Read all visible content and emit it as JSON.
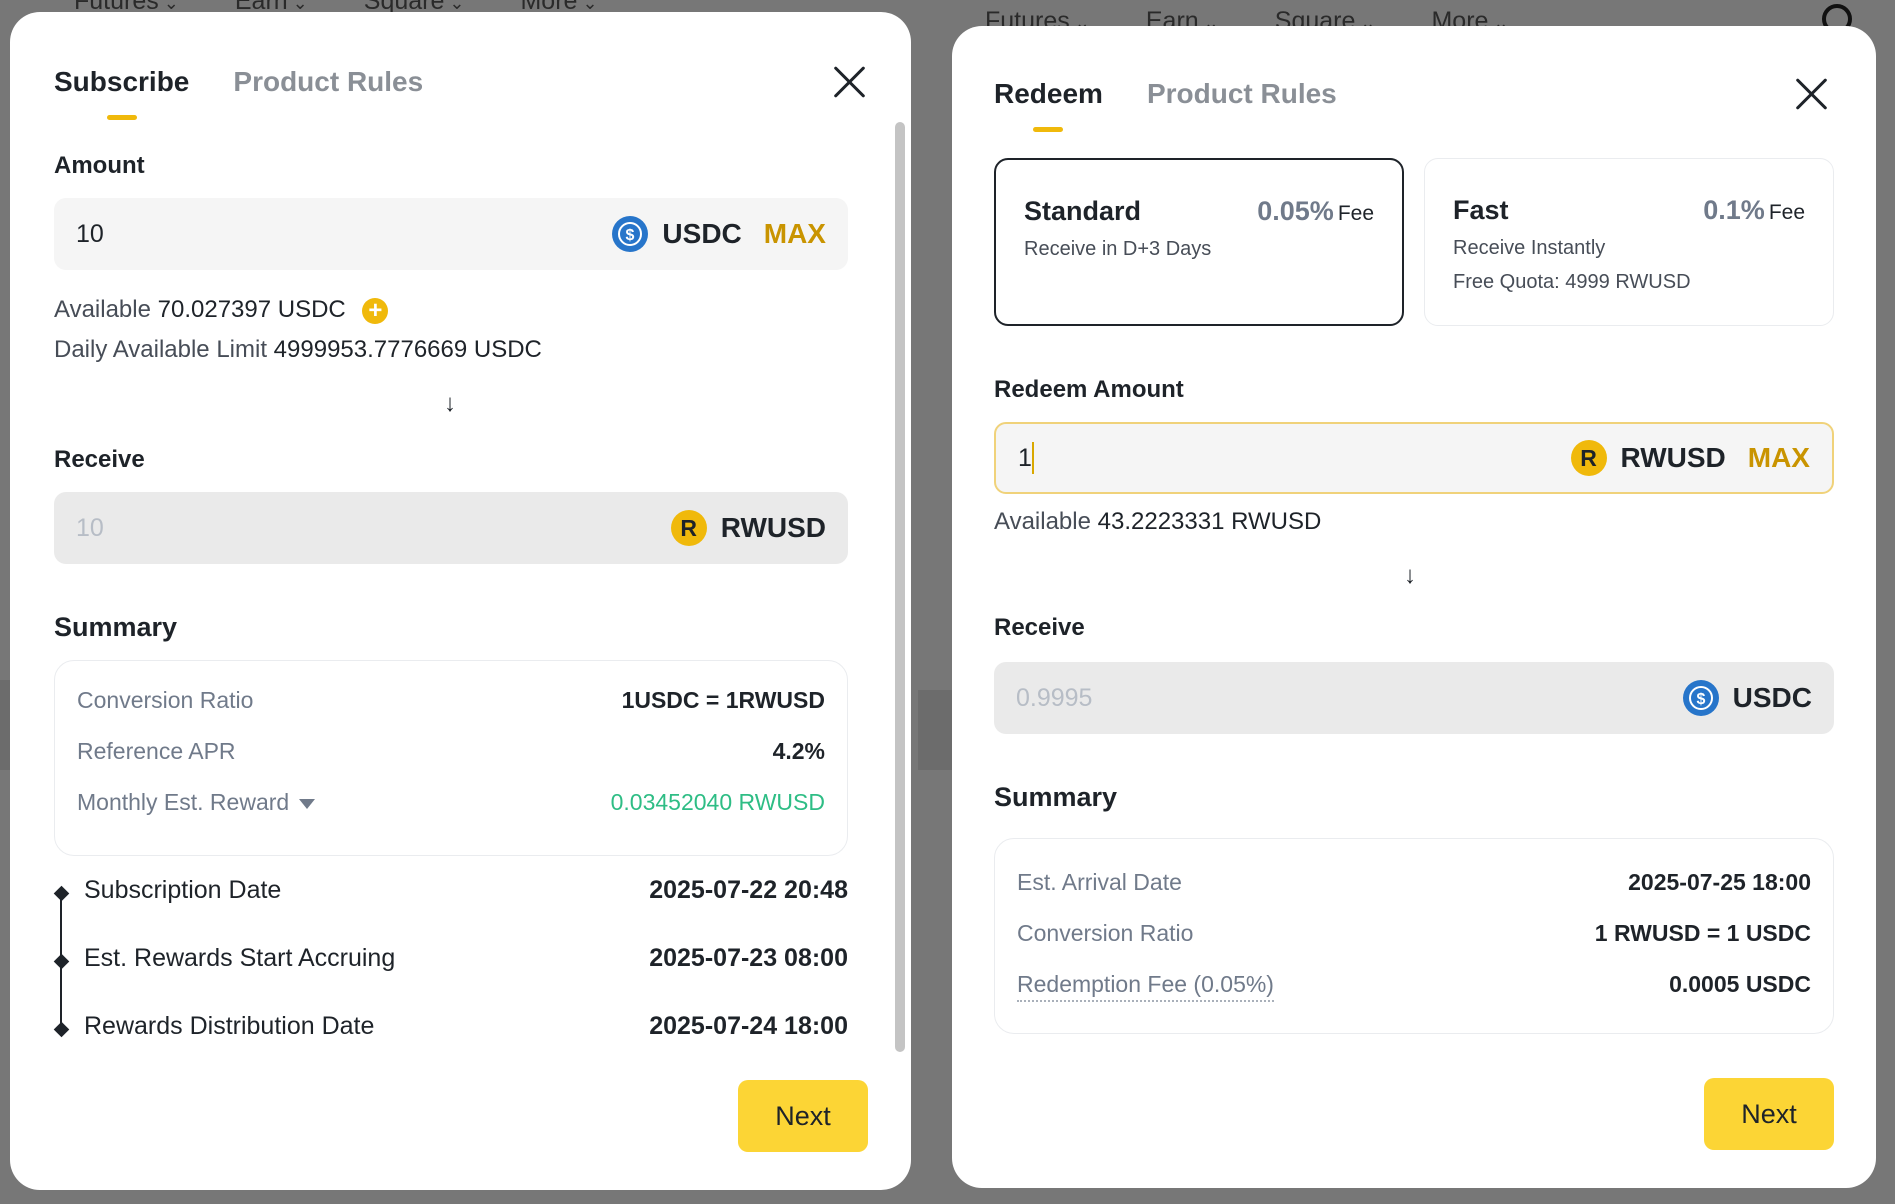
{
  "background": {
    "nav_left": [
      "Futures",
      "Earn",
      "Square",
      "More"
    ],
    "nav_right": [
      "Futures",
      "Earn",
      "Square",
      "More"
    ]
  },
  "subscribe": {
    "tabs": [
      "Subscribe",
      "Product Rules"
    ],
    "amount_label": "Amount",
    "amount_value": "10",
    "currency": "USDC",
    "max_label": "MAX",
    "available_label": "Available",
    "available_value": "70.027397 USDC",
    "daily_limit_label": "Daily Available Limit",
    "daily_limit_value": "4999953.7776669 USDC",
    "arrow": "↓",
    "receive_label": "Receive",
    "receive_value": "10",
    "receive_currency": "RWUSD",
    "summary_title": "Summary",
    "summary_rows": [
      {
        "label": "Conversion Ratio",
        "value": "1USDC = 1RWUSD"
      },
      {
        "label": "Reference APR",
        "value": "4.2%"
      },
      {
        "label": "Monthly Est. Reward",
        "value": "0.03452040 RWUSD"
      }
    ],
    "timeline": [
      {
        "label": "Subscription Date",
        "value": "2025-07-22 20:48"
      },
      {
        "label": "Est. Rewards Start Accruing",
        "value": "2025-07-23 08:00"
      },
      {
        "label": "Rewards Distribution Date",
        "value": "2025-07-24 18:00"
      }
    ],
    "next_label": "Next"
  },
  "redeem": {
    "tabs": [
      "Redeem",
      "Product Rules"
    ],
    "options": [
      {
        "name": "Standard",
        "fee": "0.05%",
        "fee_suffix": "Fee",
        "line1": "Receive in D+3 Days",
        "line2": ""
      },
      {
        "name": "Fast",
        "fee": "0.1%",
        "fee_suffix": "Fee",
        "line1": "Receive Instantly",
        "line2": "Free Quota: 4999 RWUSD"
      }
    ],
    "amount_label": "Redeem Amount",
    "amount_value": "1",
    "currency": "RWUSD",
    "max_label": "MAX",
    "available_label": "Available",
    "available_value": "43.2223331 RWUSD",
    "arrow": "↓",
    "receive_label": "Receive",
    "receive_value": "0.9995",
    "receive_currency": "USDC",
    "summary_title": "Summary",
    "summary_rows": [
      {
        "label": "Est. Arrival Date",
        "value": "2025-07-25 18:00"
      },
      {
        "label": "Conversion Ratio",
        "value": "1 RWUSD = 1 USDC"
      },
      {
        "label": "Redemption Fee (0.05%)",
        "value": "0.0005 USDC"
      }
    ],
    "next_label": "Next"
  },
  "colors": {
    "accent": "#f0b90b",
    "button": "#fcd535",
    "reward_green": "#2ebd85",
    "usdc_blue": "#2775ca"
  }
}
